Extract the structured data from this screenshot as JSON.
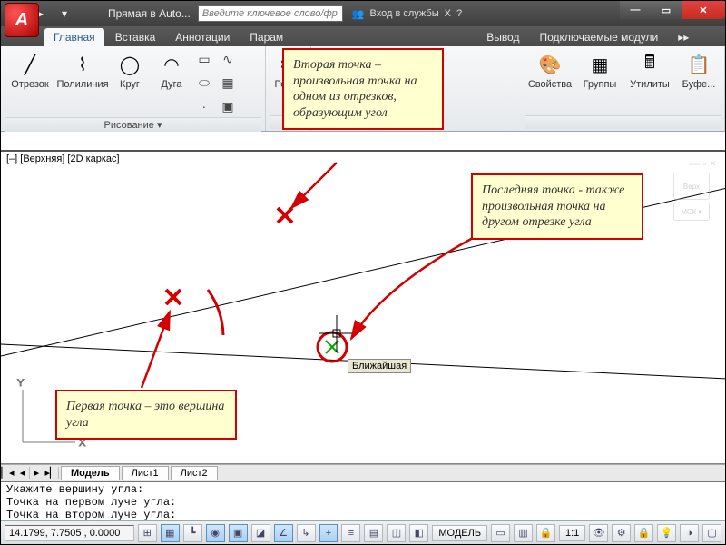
{
  "window": {
    "doc_title": "Прямая в Auto...",
    "search_placeholder": "Введите ключевое слово/фразу",
    "sign_in": "Вход в службы"
  },
  "tabs": {
    "items": [
      "Главная",
      "Вставка",
      "Аннотации",
      "Парам",
      "",
      "",
      "Вывод",
      "Подключаемые модули"
    ],
    "active": 0
  },
  "ribbon": {
    "draw_panel": "Рисование ▾",
    "buttons": {
      "line": "Отрезок",
      "polyline": "Полилиния",
      "circle": "Круг",
      "arc": "Дуга",
      "edit": "Редак",
      "props": "Свойства",
      "groups": "Группы",
      "utils": "Утилиты",
      "clip": "Буфе..."
    }
  },
  "viewport": {
    "label": "[–] [Верхняя] [2D каркас]",
    "mck": "МСК ▾"
  },
  "callouts": {
    "first": "Первая точка – это вершина угла",
    "second": "Вторая точка – произвольная точка на одном из отрезков, образующим угол",
    "third": "Последняя точка - также произвольная точка на другом отрезке угла"
  },
  "snap_tip": "Ближайшая",
  "layout_tabs": {
    "model": "Модель",
    "sheet1": "Лист1",
    "sheet2": "Лист2"
  },
  "cmd": {
    "l1": "Укажите вершину угла:",
    "l2": "Точка на первом луче угла:",
    "l3": "Точка на втором луче угла:"
  },
  "status": {
    "coords": "14.1799, 7.7505 , 0.0000",
    "model": "МОДЕЛЬ",
    "scale": "1:1"
  }
}
